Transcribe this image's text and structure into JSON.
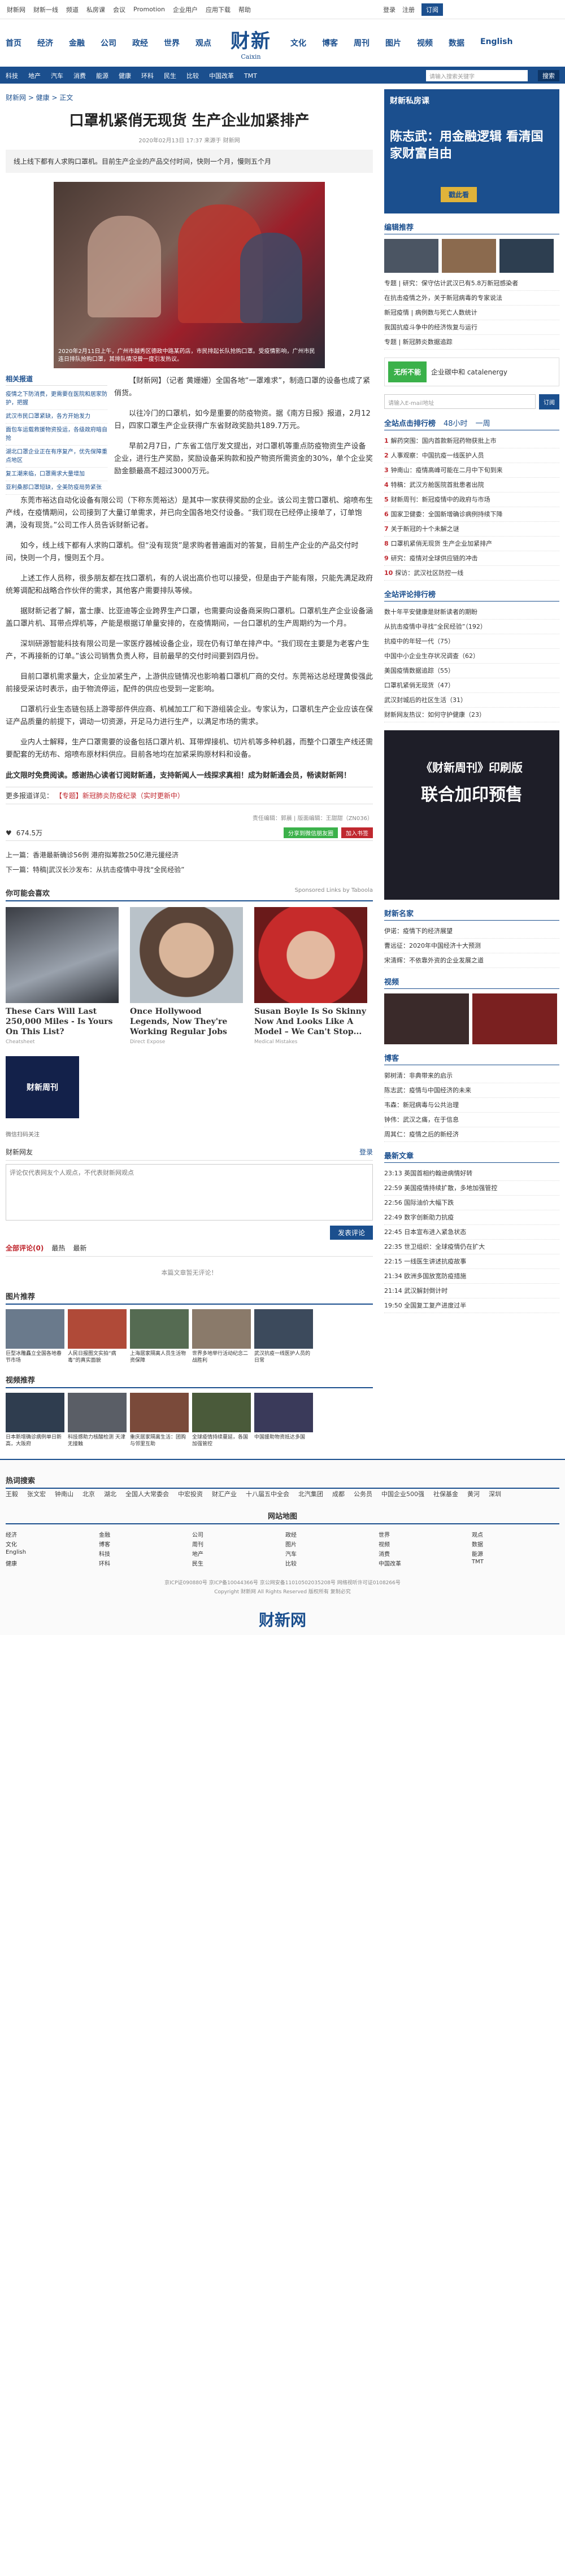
{
  "topbar": {
    "items": [
      "财新网",
      "财新一线",
      "频道",
      "私房课",
      "会议",
      "Promotion",
      "企业用户",
      "应用下载",
      "帮助"
    ],
    "login": "登录",
    "register": "注册",
    "cta": "订阅"
  },
  "header": {
    "nav_left": [
      "首页",
      "经济",
      "金融",
      "公司",
      "政经",
      "世界",
      "观点"
    ],
    "nav_right": [
      "文化",
      "博客",
      "周刊",
      "图片",
      "视频",
      "数据",
      "English"
    ],
    "logo": "财新",
    "logo_en": "Caixin"
  },
  "subnav": {
    "items": [
      "科技",
      "地产",
      "汽车",
      "消费",
      "能源",
      "健康",
      "环科",
      "民生",
      "比较",
      "中国改革",
      "TMT"
    ],
    "search_placeholder": "请输入搜索关键字",
    "search_btn": "搜索"
  },
  "article": {
    "breadcrumb": "财新网 > 健康 > 正文",
    "title": "口罩机紧俏无现货 生产企业加紧排产",
    "meta": "2020年02月13日 17:37 来源于 财新网",
    "summary": "线上线下都有人求购口罩机。目前生产企业的产品交付时间，快则一个月，慢则五个月",
    "caption": "2020年2月11日上午，广州市越秀区德政中路某药店，市民排起长队抢购口罩。受疫情影响，广州市民连日排队抢购口罩，其排队情况曾一度引发热议。",
    "related_title": "相关报道",
    "related": [
      "疫情之下防消费，更需要在医院和居家防护，把握",
      "武汉市民口罩紧缺，各方开始发力",
      "面包车运载救援物资投运，各级政府暗自抢",
      "湖北口罩企业正在有序复产，优先保障重点地区",
      "复工潮来临，口罩需求大量增加",
      "亚利桑那口罩短缺，全美防疫局势紧张"
    ],
    "paragraphs": [
      "【财新网】（记者 黄姗姗）全国各地“一罩难求”，制造口罩的设备也成了紧俏货。",
      "以往冷门的口罩机，如今是重要的防疫物资。据《南方日报》报道，2月12日，四家口罩生产企业获得广东省财政奖励共189.7万元。",
      "早前2月7日，广东省工信厅发文提出，对口罩机等重点防疫物资生产设备企业，进行生产奖励，奖励设备采购款和投产物资所需资金的30%，单个企业奖励金额最高不超过3000万元。",
      "东莞市裕达自动化设备有限公司（下称东莞裕达）是其中一家获得奖励的企业。该公司主营口罩机、熔喷布生产线，在疫情期间，公司接到了大量订单需求，并已向全国各地交付设备。“我们现在已经停止接单了，订单饱满，没有现货。”公司工作人员告诉财新记者。",
      "如今，线上线下都有人求购口罩机。但“没有现货”是求购者普遍面对的答复，目前生产企业的产品交付时间，快则一个月，慢则五个月。",
      "上述工作人员称，很多朋友都在找口罩机，有的人说出高价也可以接受，但是由于产能有限，只能先满足政府统筹调配和战略合作伙伴的需求，其他客户需要排队等候。",
      "据财新记者了解，富士康、比亚迪等企业跨界生产口罩，也需要向设备商采购口罩机。口罩机生产企业设备涵盖口罩片机、耳带点焊机等，产能是根据订单量安排的，在疫情期间，一台口罩机的生产周期约为一个月。",
      "深圳研源智能科技有限公司是一家医疗器械设备企业，现在仍有订单在排产中。“我们现在主要是为老客户生产，不再接新的订单。”该公司销售负责人称，目前最早的交付时间要到四月份。",
      "目前口罩机需求量大，企业加紧生产，上游供应链情况也影响着口罩机厂商的交付。东莞裕达总经理黄俊强此前接受采访时表示，由于物流停运，配件的供应也受到一定影响。",
      "口罩机行业生态链包括上游零部件供应商、机械加工厂和下游组装企业。专家认为，口罩机生产企业应该在保证产品质量的前提下，调动一切资源，开足马力进行生产，以满足市场的需求。",
      "业内人士解释，生产口罩需要的设备包括口罩片机、耳带焊接机、切片机等多种机器，而整个口罩生产线还需要配套的无纺布、熔喷布原材料供应。目前各地均在加紧采购原材料和设备。"
    ],
    "endnote": "此文限时免费阅读。感谢热心读者订阅财新通，支持新闻人一线探求真相！成为财新通会员，畅读财新网！",
    "more_label": "更多报道详见：",
    "more_link": "【专题】新冠肺炎防疫纪录（实时更新中）",
    "editor": "责任编辑：郭晨 | 版面编辑：王甜甜（ZN036）",
    "likes": "674.5万",
    "share_btn1": "分享到微信朋友圈",
    "share_btn2": "加入书签",
    "prev": "上一篇：香港最新确诊56例 港府拟筹款250亿港元援经济",
    "next": "下一篇：特稿|武汉长沙发布：从抗击疫情中寻找“全民经验”"
  },
  "ads": {
    "title": "你可能会喜欢",
    "sponsor": "Sponsored Links by Taboola",
    "items": [
      {
        "title": "These Cars Will Last 250,000 Miles - Is Yours On This List?",
        "src": "Cheatsheet"
      },
      {
        "title": "Once Hollywood Legends, Now They're Working Regular Jobs",
        "src": "Direct Expose"
      },
      {
        "title": "Susan Boyle Is So Skinny Now And Looks Like A Model – We Can't Stop...",
        "src": "Medical Mistakes"
      }
    ]
  },
  "weekly": {
    "label": "财新周刊",
    "sub": "微信扫码关注"
  },
  "comment": {
    "title": "财新网友",
    "login": "登录",
    "placeholder": "评论仅代表网友个人观点，不代表财新网观点",
    "send": "发表评论",
    "tabs": [
      "全部评论(0)",
      "最热",
      "最新"
    ],
    "empty": "本篇文章暂无评论！"
  },
  "pics": {
    "title": "图片推荐",
    "items": [
      "巨型冰雕矗立全国各地春节市场",
      "人民日报图文实拍“病毒”的真实面貌",
      "上海居家隔离人员生活物资保障",
      "世界多地举行活动纪念二战胜利",
      "武汉抗疫一线医护人员的日常"
    ]
  },
  "video": {
    "title": "视频推荐",
    "items": [
      "日本新增确诊病例单日新高，大阪府",
      "科技感助力核酸检测 天津无接触",
      "重庆居家隔离生活：团购与邻里互助",
      "全球疫情持续蔓延，各国加强管控",
      "中国援助物资抵达多国"
    ]
  },
  "right": {
    "ad_title": "财新私房课",
    "ad_sub": "陈志武：用金融逻辑 看清国家财富自由",
    "ad_btn": "戳此看",
    "editor_pick": "编辑推荐",
    "picks": [
      "专题 | 研究：保守估计武汉已有5.8万新冠感染者",
      "在抗击疫情之外，关于新冠病毒的专家说法",
      "新冠疫情 | 病例数与死亡人数统计",
      "我国抗疫斗争中的经济恢复与运行",
      "专题 | 新冠肺炎数据追踪"
    ],
    "sponsor_name": "无所不能",
    "sponsor_desc": "企业碳中和 catalenergy",
    "subscribe_ph": "请输入E-mail地址",
    "subscribe_btn": "订阅",
    "rank_title": "全站点击排行榜",
    "rank_tabs": [
      "48小时",
      "一周"
    ],
    "rank": [
      "解药突围：国内首款新冠药物获批上市",
      "人事观察：中国抗疫一线医护人员",
      "钟南山：疫情高峰可能在二月中下旬到来",
      "特稿：武汉方舱医院首批患者出院",
      "财新周刊：新冠疫情中的政府与市场",
      "国家卫健委：全国新增确诊病例持续下降",
      "关于新冠的十个未解之谜",
      "口罩机紧俏无现货 生产企业加紧排产",
      "研究：疫情对全球供应链的冲击",
      "探访：武汉社区防控一线"
    ],
    "comment_title": "全站评论排行榜",
    "comments": [
      "数十年平安健康是财新读者的期盼",
      "从抗击疫情中寻找“全民经验”（192）",
      "抗疫中的年轻一代（75）",
      "中国中小企业生存状况调查（62）",
      "美国疫情数据追踪（55）",
      "口罩机紧俏无现货（47）",
      "武汉封城后的社区生活（31）",
      "财新网友热议：如何守护健康（23）"
    ],
    "print_title": "《财新周刊》印刷版",
    "print_big": "联合加印预售",
    "columnist_title": "财新名家",
    "columnists": [
      "伊诺：疫情下的经济展望",
      "曹远征：2020年中国经济十大预测",
      "宋清辉：不依靠外资的企业发展之道"
    ],
    "video_title": "视频",
    "blog_title": "博客",
    "blogs": [
      "郭树清：非典带来的启示",
      "陈志武：疫情与中国经济的未来",
      "韦森：新冠病毒与公共治理",
      "钟伟：武汉之痛，在于信息",
      "周其仁：疫情之后的新经济"
    ],
    "news_title": "最新文章",
    "news": [
      "23:13 英国首相约翰逊病情好转",
      "22:59 美国疫情持续扩散，多地加强管控",
      "22:56 国际油价大幅下跌",
      "22:49 数字创新助力抗疫",
      "22:45 日本宣布进入紧急状态",
      "22:35 世卫组织：全球疫情仍在扩大",
      "22:15 一线医生讲述抗疫故事",
      "21:34 欧洲多国放宽防疫措施",
      "21:14 武汉解封倒计时",
      "19:50 全国复工复产进度过半"
    ]
  },
  "footer": {
    "hot_title": "热词搜索",
    "hot": [
      "王毅",
      "张文宏",
      "钟南山",
      "北京",
      "湖北",
      "全国人大常委会",
      "中宏投资",
      "财汇产业",
      "十八届五中全会",
      "北汽集团",
      "成都",
      "公务员",
      "中国企业500强",
      "社保基金",
      "黄河",
      "深圳"
    ],
    "map_title": "网站地图",
    "map": [
      "经济",
      "金融",
      "公司",
      "政经",
      "世界",
      "观点",
      "文化",
      "博客",
      "周刊",
      "图片",
      "视频",
      "数据",
      "English",
      "科技",
      "地产",
      "汽车",
      "消费",
      "能源",
      "健康",
      "环科",
      "民生",
      "比较",
      "中国改革",
      "TMT"
    ],
    "legal": "京ICP证090880号 京ICP备10044366号 京公网安备11010502035208号 网络视听许可证0108266号",
    "copyright": "Copyright 财新网 All Rights Reserved 版权所有 复制必究",
    "logo": "财新网"
  }
}
